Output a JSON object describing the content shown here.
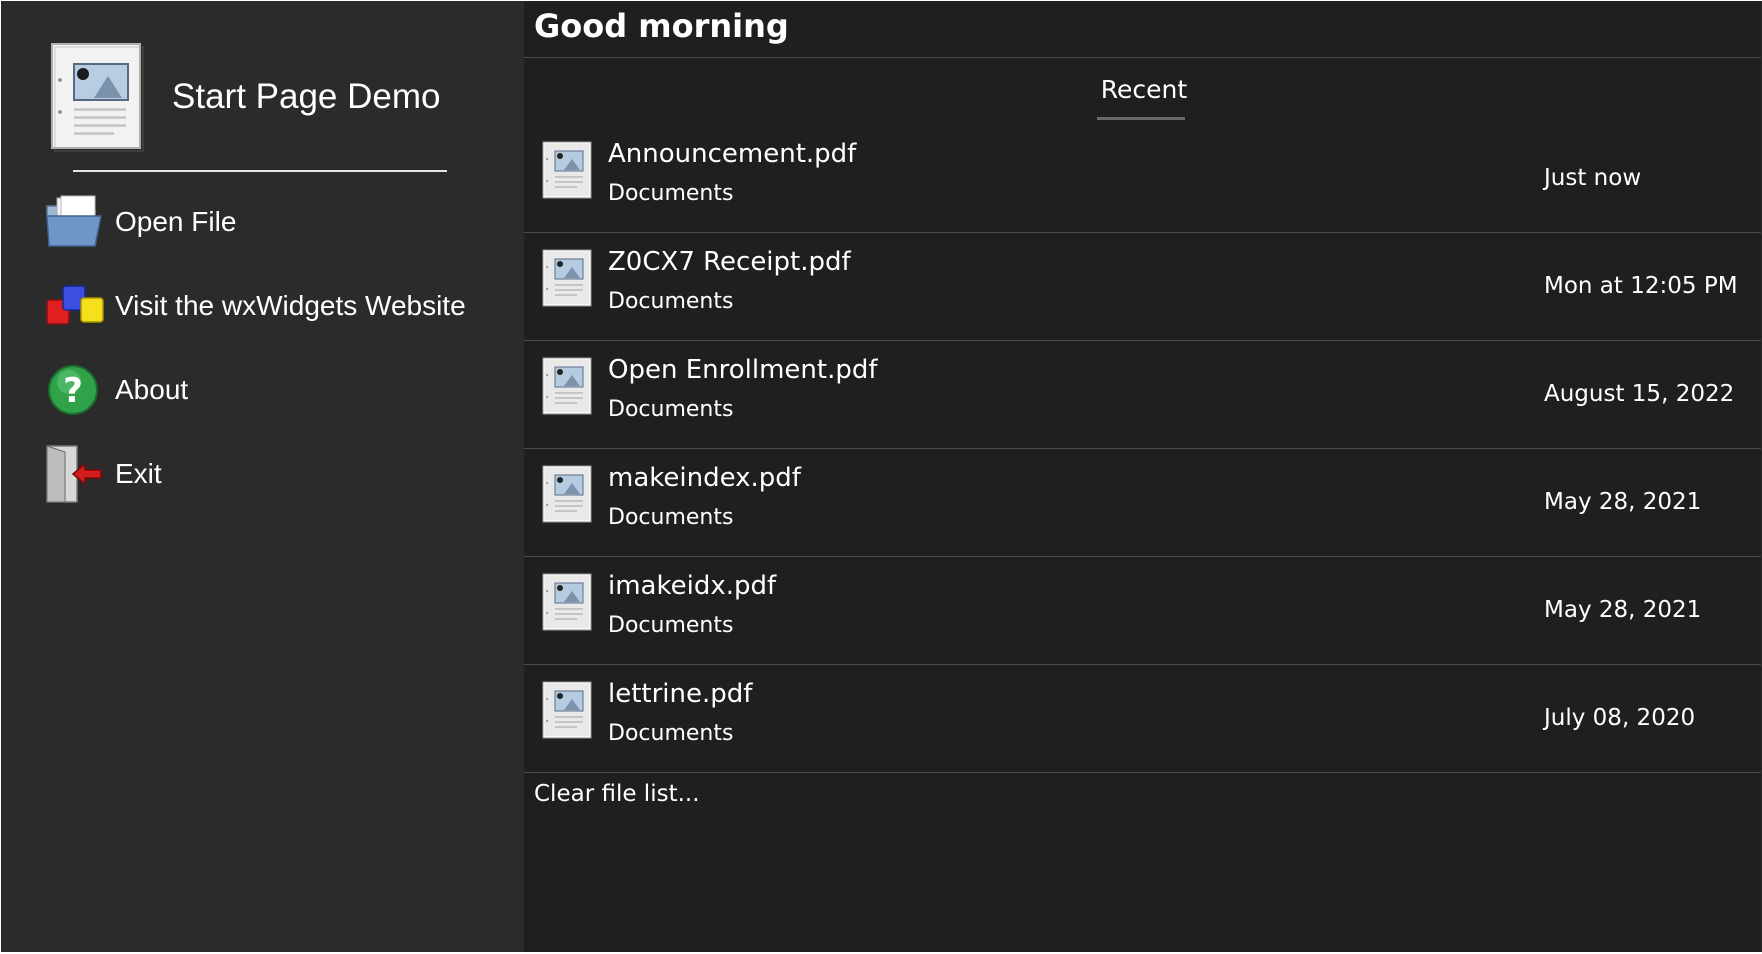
{
  "app": {
    "title": "Start Page Demo",
    "doc_icon": "document-image-icon"
  },
  "sidebar": {
    "items": [
      {
        "label": "Open File",
        "icon": "open-folder-icon"
      },
      {
        "label": "Visit the wxWidgets Website",
        "icon": "wxwidgets-logo-icon"
      },
      {
        "label": "About",
        "icon": "help-question-icon"
      },
      {
        "label": "Exit",
        "icon": "exit-door-icon"
      }
    ]
  },
  "main": {
    "greeting": "Good morning",
    "tabs": [
      {
        "label": "Recent",
        "selected": true
      }
    ],
    "files": [
      {
        "name": "Announcement.pdf",
        "folder": "Documents",
        "date": "Just now"
      },
      {
        "name": "Z0CX7 Receipt.pdf",
        "folder": "Documents",
        "date": "Mon at 12:05 PM"
      },
      {
        "name": "Open Enrollment.pdf",
        "folder": "Documents",
        "date": "August 15, 2022"
      },
      {
        "name": "makeindex.pdf",
        "folder": "Documents",
        "date": "May 28, 2021"
      },
      {
        "name": "imakeidx.pdf",
        "folder": "Documents",
        "date": "May 28, 2021"
      },
      {
        "name": "lettrine.pdf",
        "folder": "Documents",
        "date": "July 08, 2020"
      }
    ],
    "clear_label": "Clear file list..."
  },
  "colors": {
    "sidebar_bg": "#2b2b2b",
    "main_bg": "#1f1f1f",
    "divider": "#4a4a4a",
    "text": "#ffffff"
  }
}
